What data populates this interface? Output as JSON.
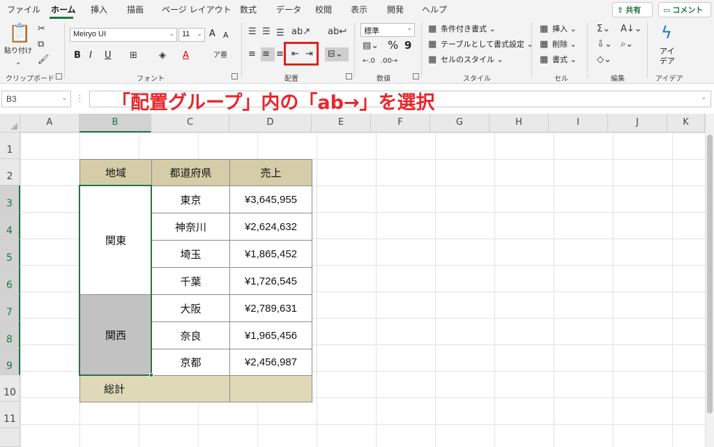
{
  "tabs": [
    "ファイル",
    "ホーム",
    "挿入",
    "描画",
    "ページ レイアウト",
    "数式",
    "データ",
    "校閲",
    "表示",
    "開発",
    "ヘルプ"
  ],
  "share_label": "共有",
  "comment_label": "コメント",
  "groups": {
    "clipboard": "クリップボード",
    "font": "フォント",
    "alignment": "配置",
    "number": "数値",
    "styles": "スタイル",
    "cells": "セル",
    "editing": "編集",
    "ideas": "アイデア"
  },
  "clipboard": {
    "paste": "貼り付け"
  },
  "font": {
    "name": "Meiryo UI",
    "size": "11",
    "bold": "B",
    "italic": "I",
    "underline": "U",
    "increase": "A",
    "decrease": "A"
  },
  "number": {
    "format": "標準",
    "percent": "%",
    "comma": "9"
  },
  "styles": {
    "conditional": "条件付き書式 ⌄",
    "as_table": "テーブルとして書式設定 ⌄",
    "cell_styles": "セルのスタイル ⌄"
  },
  "cells": {
    "insert": "挿入 ⌄",
    "delete": "削除 ⌄",
    "format": "書式 ⌄"
  },
  "ideas": {
    "label1": "アイ",
    "label2": "デア"
  },
  "namebox": "B3",
  "annotation": "「配置グループ」内の「ab→」を選択",
  "columns": [
    "A",
    "B",
    "C",
    "D",
    "E",
    "F",
    "G",
    "H",
    "I",
    "J",
    "K"
  ],
  "rows": [
    "1",
    "2",
    "3",
    "4",
    "5",
    "6",
    "7",
    "8",
    "9",
    "10",
    "11"
  ],
  "table": {
    "headers": [
      "地域",
      "都道府県",
      "売上"
    ],
    "regions": [
      "関東",
      "関西"
    ],
    "prefectures": [
      "東京",
      "神奈川",
      "埼玉",
      "千葉",
      "大阪",
      "奈良",
      "京都"
    ],
    "sales": [
      "¥3,645,955",
      "¥2,624,632",
      "¥1,865,452",
      "¥1,726,545",
      "¥2,789,631",
      "¥1,965,456",
      "¥2,456,987"
    ],
    "total_label": "総計"
  },
  "colors": {
    "accent": "#217346",
    "header_fill": "#d5cda7",
    "total_fill": "#e0d9b8",
    "selected_fill": "#c2c2c2",
    "annotation": "#e8262c"
  }
}
